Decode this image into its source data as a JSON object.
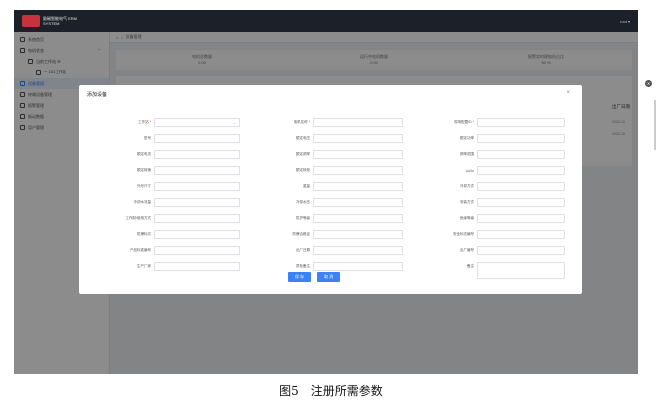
{
  "app": {
    "logo_text": "励磁智能电气 ERM SYSTEM",
    "user": "root ▾"
  },
  "sidebar": {
    "items": [
      {
        "label": "系统首页",
        "cls": ""
      },
      {
        "label": "电机状态",
        "cls": "",
        "caret": "⌃"
      },
      {
        "label": "当前工作站 ☰",
        "cls": "sb-sub"
      },
      {
        "label": "一 1111工作站",
        "cls": "sb-sub2"
      },
      {
        "label": "设备管理",
        "cls": "active"
      },
      {
        "label": "终端设备管理",
        "cls": ""
      },
      {
        "label": "报警管理",
        "cls": ""
      },
      {
        "label": "振动数据",
        "cls": ""
      },
      {
        "label": "用户管理",
        "cls": ""
      }
    ]
  },
  "breadcrumb": {
    "home_icon": "home-icon",
    "separator": "/",
    "current": "设备管理"
  },
  "stats": [
    {
      "label": "电机总数量",
      "value": "2.00"
    },
    {
      "label": "运行中电机数量",
      "value": "0.00"
    },
    {
      "label": "报警实时理电机占比",
      "value": "50 %"
    }
  ],
  "table": {
    "header": "出厂日期",
    "rows": [
      "2022-10",
      "2022-10"
    ]
  },
  "dialog": {
    "title": "添加设备",
    "close": "×",
    "fields": [
      [
        {
          "label": "工作站",
          "required": true,
          "type": "select"
        },
        {
          "label": "电机名称",
          "required": true
        },
        {
          "label": "现场配置ID",
          "required": true
        }
      ],
      [
        {
          "label": "型号"
        },
        {
          "label": "额定电压"
        },
        {
          "label": "额定功率"
        }
      ],
      [
        {
          "label": "额定电流"
        },
        {
          "label": "额定频率"
        },
        {
          "label": "频率范围"
        }
      ],
      [
        {
          "label": "额定转速"
        },
        {
          "label": "额定转矩"
        },
        {
          "label": "Uo/Io"
        }
      ],
      [
        {
          "label": "外形尺寸"
        },
        {
          "label": "重量"
        },
        {
          "label": "冷却方式"
        }
      ],
      [
        {
          "label": "冷却水流量"
        },
        {
          "label": "冷却水压"
        },
        {
          "label": "安装方式"
        }
      ],
      [
        {
          "label": "工作制/使用方式"
        },
        {
          "label": "防护等级"
        },
        {
          "label": "绝缘等级"
        }
      ],
      [
        {
          "label": "防爆标志"
        },
        {
          "label": "防爆合格证"
        },
        {
          "label": "安全标志编号"
        }
      ],
      [
        {
          "label": "产品标准编号"
        },
        {
          "label": "出厂日期"
        },
        {
          "label": "出厂编号"
        }
      ],
      [
        {
          "label": "生产厂家"
        },
        {
          "label": "质检备注"
        },
        {
          "label": "备注",
          "type": "textarea"
        }
      ]
    ],
    "buttons": {
      "save": "保 存",
      "cancel": "取 消"
    }
  },
  "caption": "图5　注册所需参数"
}
